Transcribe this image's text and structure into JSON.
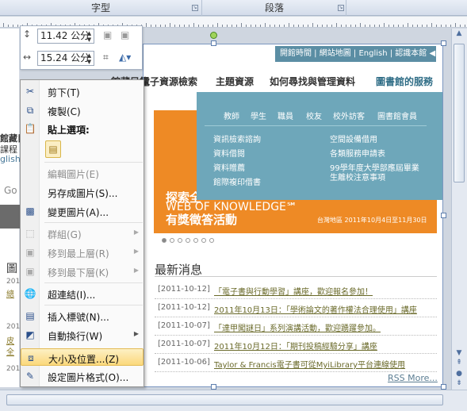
{
  "ribbon": {
    "groups": [
      "字型",
      "段落"
    ],
    "launcher_icon": "dialog-launcher-icon"
  },
  "mini_toolbar": {
    "height_value": "11.42 公分",
    "width_value": "15.24 公分",
    "icons": [
      "shape-height-icon",
      "shape-width-icon",
      "bring-forward-icon",
      "send-backward-icon",
      "crop-icon",
      "text-wrap-icon"
    ]
  },
  "context_menu": {
    "items": [
      {
        "label": "剪下(T)",
        "icon": "scissors-icon",
        "enabled": true
      },
      {
        "label": "複製(C)",
        "icon": "copy-icon",
        "enabled": true
      },
      {
        "label": "貼上選項:",
        "icon": "paste-icon",
        "enabled": true
      },
      {
        "label": "編輯圖片(E)",
        "icon": "",
        "enabled": false
      },
      {
        "label": "另存成圖片(S)...",
        "icon": "",
        "enabled": true
      },
      {
        "label": "變更圖片(A)...",
        "icon": "change-picture-icon",
        "enabled": true
      },
      {
        "label": "群組(G)",
        "icon": "group-icon",
        "enabled": false
      },
      {
        "label": "移到最上層(R)",
        "icon": "bring-to-front-icon",
        "enabled": false
      },
      {
        "label": "移到最下層(K)",
        "icon": "send-to-back-icon",
        "enabled": false
      },
      {
        "label": "超連結(I)...",
        "icon": "hyperlink-icon",
        "enabled": true
      },
      {
        "label": "插入標號(N)...",
        "icon": "caption-icon",
        "enabled": true
      },
      {
        "label": "自動換行(W)",
        "icon": "wrap-text-icon",
        "enabled": true
      },
      {
        "label": "大小及位置...(Z)",
        "icon": "size-position-icon",
        "enabled": true,
        "highlighted": true
      },
      {
        "label": "設定圖片格式(O)...",
        "icon": "format-picture-icon",
        "enabled": true
      }
    ]
  },
  "web": {
    "topnav": "開館時間 | 網站地圖 | English | 認識本館 ◀",
    "mainnav": [
      "館藏目錄",
      "電子資源檢索",
      "主題資源",
      "如何尋找與管理資料",
      "圖書館的服務"
    ],
    "roles": [
      "教師",
      "學生",
      "職員",
      "校友",
      "校外訪客",
      "圖書館會員"
    ],
    "services_left": [
      "資訊檢索諮詢",
      "資料借閱",
      "資料贈薦",
      "館際複印借書"
    ],
    "services_right": [
      "空間設備借用",
      "各類服務申請表",
      "99學年度大學部應屆畢業",
      "生離校注意事項"
    ],
    "banner": {
      "line1": "探索全",
      "line2": "WEB OF KNOWLEDGE℠",
      "line3": "有獎徵答活動",
      "date": "台灣地區 2011年10月4日至11月30日"
    },
    "news_title": "最新消息",
    "news": [
      {
        "date": "[2011-10-12]",
        "title": "「電子書與行動學習」講座，歡迎報名參加！"
      },
      {
        "date": "[2011-10-12]",
        "title": "2011年10月13日：「學術論文的著作權法合理使用」講座"
      },
      {
        "date": "[2011-10-07]",
        "title": "「達甲闖謎日」系列演講活動，歡迎踴躍參加。"
      },
      {
        "date": "[2011-10-07]",
        "title": "2011年10月12日：「期刊投稿經驗分享」講座"
      },
      {
        "date": "[2011-10-06]",
        "title": "Taylor & Francis電子書可從MyiLibrary平台連線使用"
      }
    ],
    "rss": "RSS More...",
    "left_fragments": [
      "館藏目",
      "課程",
      "ng",
      "請輸入",
      "glish",
      "Go",
      "圖",
      "201",
      "總",
      "201",
      "皮",
      "全",
      "201"
    ]
  },
  "colors": {
    "accent": "#6ea7ba",
    "banner": "#ee8a25",
    "highlight": "#fbd87b"
  }
}
